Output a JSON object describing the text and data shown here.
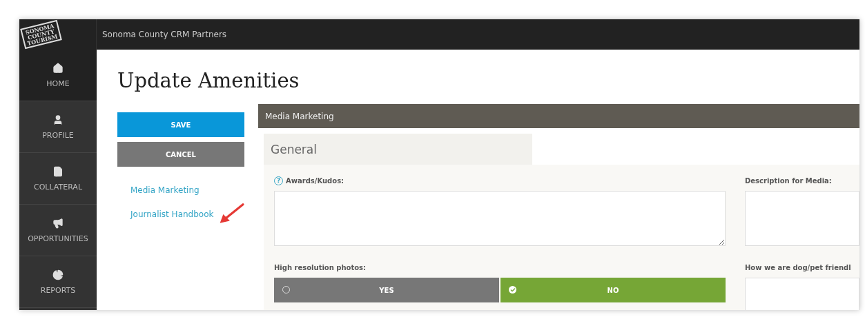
{
  "logo": {
    "lines": [
      "SONOMA",
      "COUNTY",
      "TOURISM"
    ]
  },
  "top_bar": {
    "title": "Sonoma County CRM Partners"
  },
  "sidebar": {
    "items": [
      {
        "label": "HOME",
        "kind": "home",
        "selected": true
      },
      {
        "label": "PROFILE",
        "kind": "profile",
        "selected": false
      },
      {
        "label": "COLLATERAL",
        "kind": "collateral",
        "selected": false
      },
      {
        "label": "OPPORTUNITIES",
        "kind": "opportunities",
        "selected": false
      },
      {
        "label": "REPORTS",
        "kind": "reports",
        "selected": false
      }
    ]
  },
  "page": {
    "title": "Update Amenities"
  },
  "actions": [
    {
      "label": "SAVE",
      "kind": "primary"
    },
    {
      "label": "CANCEL",
      "kind": "secondary"
    }
  ],
  "section_links": [
    {
      "label": "Media Marketing",
      "pointed": false
    },
    {
      "label": "Journalist Handbook",
      "pointed": true
    }
  ],
  "panel": {
    "title": "Media Marketing",
    "tab": "General",
    "fields": {
      "awards": {
        "label": "Awards/Kudos:",
        "help": "?"
      },
      "photos": {
        "label": "High resolution photos:",
        "options": [
          {
            "label": "YES",
            "selected": false
          },
          {
            "label": "NO",
            "selected": true
          }
        ]
      },
      "description": {
        "label": "Description for Media:"
      },
      "pets": {
        "label": "How we are dog/pet friendl"
      }
    }
  }
}
